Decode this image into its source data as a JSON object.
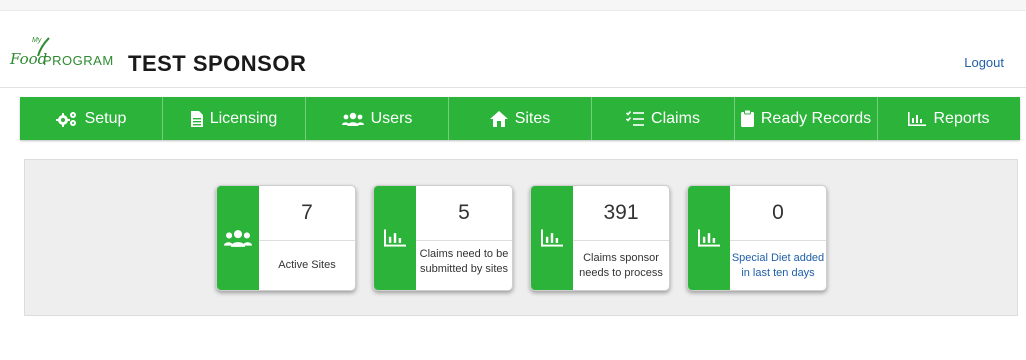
{
  "header": {
    "logo": {
      "my": "My",
      "food": "Food",
      "program": "PROGRAM"
    },
    "sponsor_name": "TEST SPONSOR",
    "logout_label": "Logout"
  },
  "nav": {
    "items": [
      {
        "label": "Setup",
        "icon": "gears-icon"
      },
      {
        "label": "Licensing",
        "icon": "document-icon"
      },
      {
        "label": "Users",
        "icon": "users-icon"
      },
      {
        "label": "Sites",
        "icon": "home-icon"
      },
      {
        "label": "Claims",
        "icon": "checklist-icon"
      },
      {
        "label": "Ready Records",
        "icon": "clipboard-icon"
      },
      {
        "label": "Reports",
        "icon": "bar-chart-icon"
      }
    ]
  },
  "dashboard": {
    "cards": [
      {
        "value": "7",
        "label": "Active Sites",
        "icon": "users-icon"
      },
      {
        "value": "5",
        "label": "Claims need to be submitted by sites",
        "icon": "bar-chart-icon"
      },
      {
        "value": "391",
        "label": "Claims sponsor needs to process",
        "icon": "bar-chart-icon"
      },
      {
        "value": "0",
        "label": "Special Diet added in last ten days",
        "icon": "bar-chart-icon"
      }
    ]
  },
  "colors": {
    "accent_green": "#2bb33a",
    "link_blue": "#1f5fa8"
  }
}
